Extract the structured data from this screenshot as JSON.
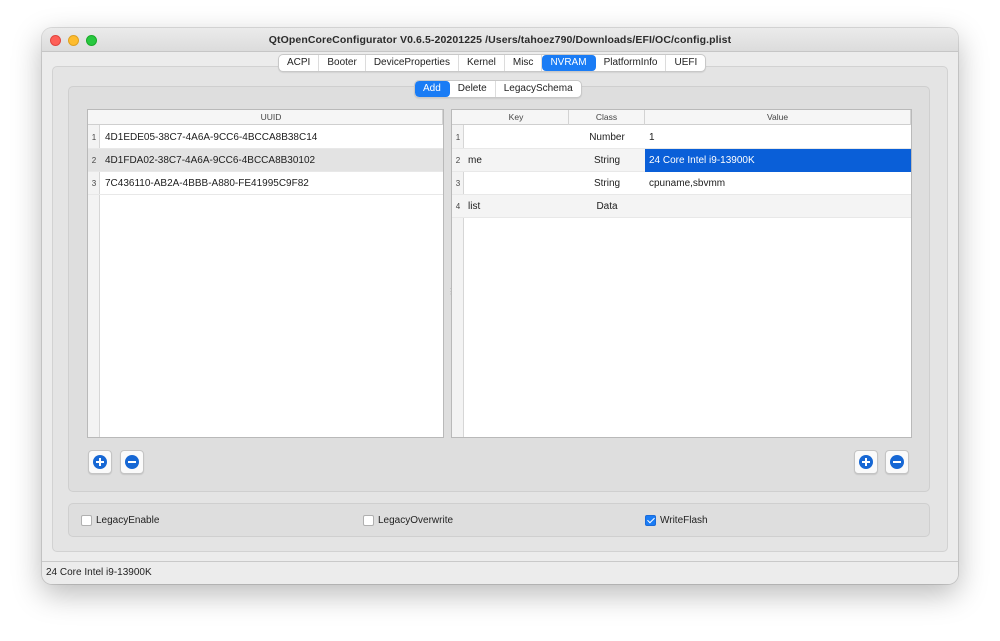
{
  "window": {
    "title": "QtOpenCoreConfigurator  V0.6.5-20201225    /Users/tahoez790/Downloads/EFI/OC/config.plist"
  },
  "top_tabs": [
    {
      "label": "ACPI",
      "active": false
    },
    {
      "label": "Booter",
      "active": false
    },
    {
      "label": "DeviceProperties",
      "active": false
    },
    {
      "label": "Kernel",
      "active": false
    },
    {
      "label": "Misc",
      "active": false
    },
    {
      "label": "NVRAM",
      "active": true
    },
    {
      "label": "PlatformInfo",
      "active": false
    },
    {
      "label": "UEFI",
      "active": false
    }
  ],
  "sub_tabs": [
    {
      "label": "Add",
      "active": true
    },
    {
      "label": "Delete",
      "active": false
    },
    {
      "label": "LegacySchema",
      "active": false
    }
  ],
  "uuid_table": {
    "header": "UUID",
    "rows": [
      {
        "num": "1",
        "uuid": "4D1EDE05-38C7-4A6A-9CC6-4BCCA8B38C14"
      },
      {
        "num": "2",
        "uuid": "4D1FDA02-38C7-4A6A-9CC6-4BCCA8B30102"
      },
      {
        "num": "3",
        "uuid": "7C436110-AB2A-4BBB-A880-FE41995C9F82"
      }
    ]
  },
  "kv_table": {
    "headers": {
      "key": "Key",
      "class": "Class",
      "value": "Value"
    },
    "rows": [
      {
        "num": "1",
        "key": "",
        "class": "Number",
        "value": "1"
      },
      {
        "num": "2",
        "key": "me",
        "class": "String",
        "value": "24 Core Intel i9-13900K"
      },
      {
        "num": "3",
        "key": "",
        "class": "String",
        "value": "cpuname,sbvmm"
      },
      {
        "num": "4",
        "key": "list",
        "class": "Data",
        "value": ""
      }
    ]
  },
  "icons": {
    "add": "plus-circle-icon",
    "remove": "minus-circle-icon"
  },
  "checkboxes": [
    {
      "label": "LegacyEnable",
      "checked": false
    },
    {
      "label": "LegacyOverwrite",
      "checked": false
    },
    {
      "label": "WriteFlash",
      "checked": true
    }
  ],
  "status": {
    "text": "24 Core Intel i9-13900K"
  },
  "colors": {
    "accent": "#1a7cf5",
    "selection": "#0a5fd8",
    "close": "#fe5f57",
    "minimize": "#febc2e",
    "zoom": "#28c840"
  }
}
